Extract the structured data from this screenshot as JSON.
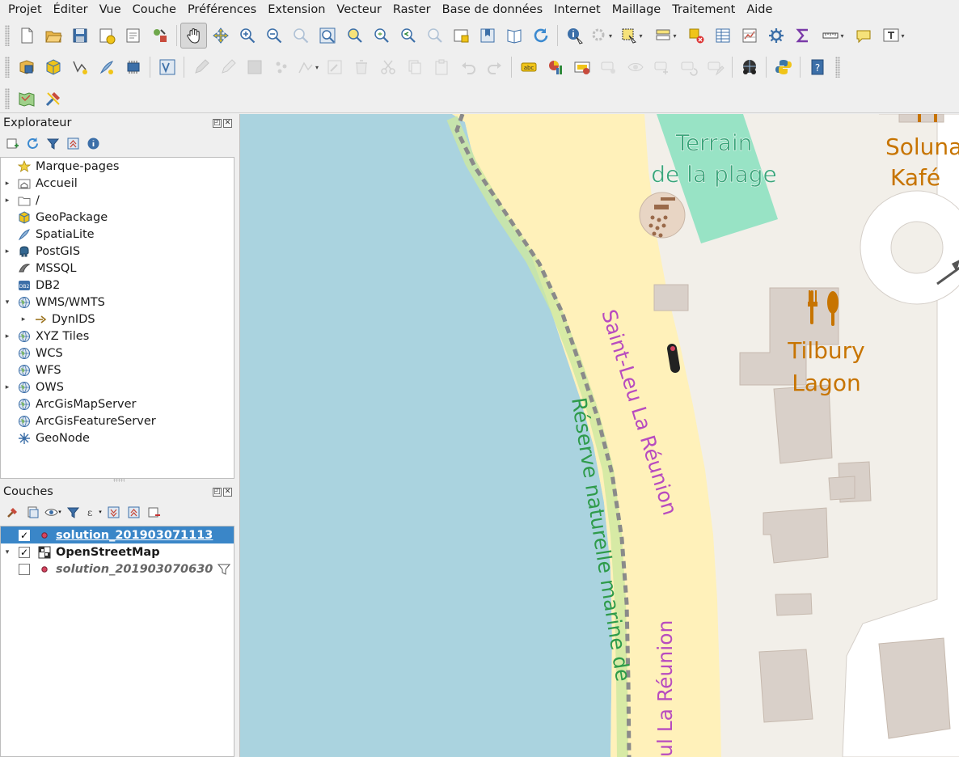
{
  "menu": [
    "Projet",
    "Éditer",
    "Vue",
    "Couche",
    "Préférences",
    "Extension",
    "Vecteur",
    "Raster",
    "Base de données",
    "Internet",
    "Maillage",
    "Traitement",
    "Aide"
  ],
  "explorer": {
    "title": "Explorateur",
    "items": [
      {
        "label": "Marque-pages",
        "icon": "star-icon",
        "expand": ""
      },
      {
        "label": "Accueil",
        "icon": "home-folder-icon",
        "expand": "▸"
      },
      {
        "label": "/",
        "icon": "folder-icon",
        "expand": "▸"
      },
      {
        "label": "GeoPackage",
        "icon": "geopackage-icon",
        "expand": ""
      },
      {
        "label": "SpatiaLite",
        "icon": "spatialite-icon",
        "expand": ""
      },
      {
        "label": "PostGIS",
        "icon": "postgis-elephant-icon",
        "expand": "▸"
      },
      {
        "label": "MSSQL",
        "icon": "mssql-icon",
        "expand": ""
      },
      {
        "label": "DB2",
        "icon": "db2-icon",
        "expand": ""
      },
      {
        "label": "WMS/WMTS",
        "icon": "globe-icon",
        "expand": "▾"
      },
      {
        "label": "DynIDS",
        "icon": "wms-connection-icon",
        "expand": "▸",
        "child": true
      },
      {
        "label": "XYZ Tiles",
        "icon": "globe-icon",
        "expand": "▸"
      },
      {
        "label": "WCS",
        "icon": "globe-icon",
        "expand": ""
      },
      {
        "label": "WFS",
        "icon": "globe-icon",
        "expand": ""
      },
      {
        "label": "OWS",
        "icon": "globe-icon",
        "expand": "▸"
      },
      {
        "label": "ArcGisMapServer",
        "icon": "globe-icon",
        "expand": ""
      },
      {
        "label": "ArcGisFeatureServer",
        "icon": "globe-icon",
        "expand": ""
      },
      {
        "label": "GeoNode",
        "icon": "geonode-icon",
        "expand": ""
      }
    ]
  },
  "layers": {
    "title": "Couches",
    "items": [
      {
        "name": "solution_201903071113",
        "checked": "✓",
        "expand": "",
        "selected": true
      },
      {
        "name": "OpenStreetMap",
        "checked": "✓",
        "expand": "▾",
        "selected": false
      },
      {
        "name": "solution_201903070630",
        "checked": "",
        "expand": "",
        "selected": false
      }
    ]
  },
  "map": {
    "labels": {
      "terrain_line1": "Terrain",
      "terrain_line2": "de la plage",
      "tilbury_line1": "Tilbury",
      "tilbury_line2": "Lagon",
      "solu_line1": "Soluna",
      "solu_line2": "Kafé",
      "road1": "Saint-Leu  La Réunion",
      "road2": "ul La Réunion",
      "reserve": "Réserve naturelle marine de"
    },
    "colors": {
      "sea": "#aad3df",
      "sand": "#fff1ba",
      "land": "#f2efe9",
      "building": "#d9d0c9",
      "pitch": "#88e0be",
      "road_label": "#b84cbf",
      "reserve_label": "#2e9b4a",
      "poi": "#c77400"
    }
  }
}
